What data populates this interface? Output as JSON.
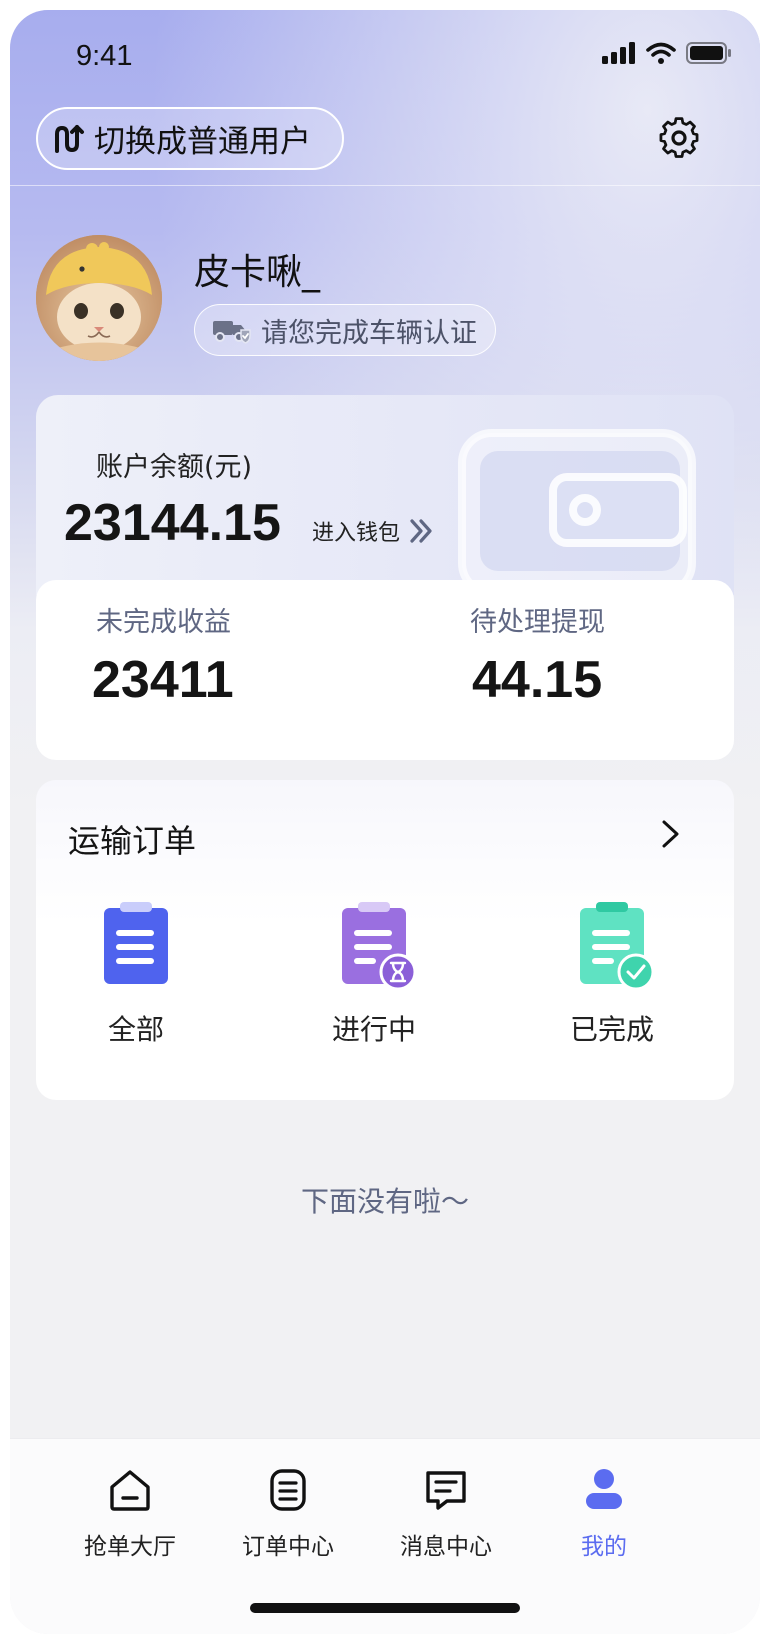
{
  "status_bar": {
    "time": "9:41"
  },
  "header": {
    "switch_label": "切换成普通用户"
  },
  "profile": {
    "username": "皮卡啾_",
    "verify_label": "请您完成车辆认证"
  },
  "balance": {
    "title": "账户余额(元)",
    "amount": "23144.15",
    "wallet_link": "进入钱包"
  },
  "stats": {
    "pending_income_label": "未完成收益",
    "pending_income_value": "23411",
    "pending_withdraw_label": "待处理提现",
    "pending_withdraw_value": "44.15"
  },
  "orders": {
    "title": "运输订单",
    "items": [
      {
        "label": "全部",
        "icon": "clipboard-icon"
      },
      {
        "label": "进行中",
        "icon": "clipboard-hourglass-icon"
      },
      {
        "label": "已完成",
        "icon": "clipboard-check-icon"
      }
    ]
  },
  "end_text": "下面没有啦～",
  "tabs": [
    {
      "label": "抢单大厅",
      "icon": "home-icon"
    },
    {
      "label": "订单中心",
      "icon": "list-document-icon"
    },
    {
      "label": "消息中心",
      "icon": "message-icon"
    },
    {
      "label": "我的",
      "icon": "profile-icon",
      "active": true
    }
  ],
  "colors": {
    "accent": "#5b6cf0",
    "blue_icon": "#4f63ee",
    "purple_icon": "#9a6fe0",
    "green_icon": "#45d9b6"
  }
}
